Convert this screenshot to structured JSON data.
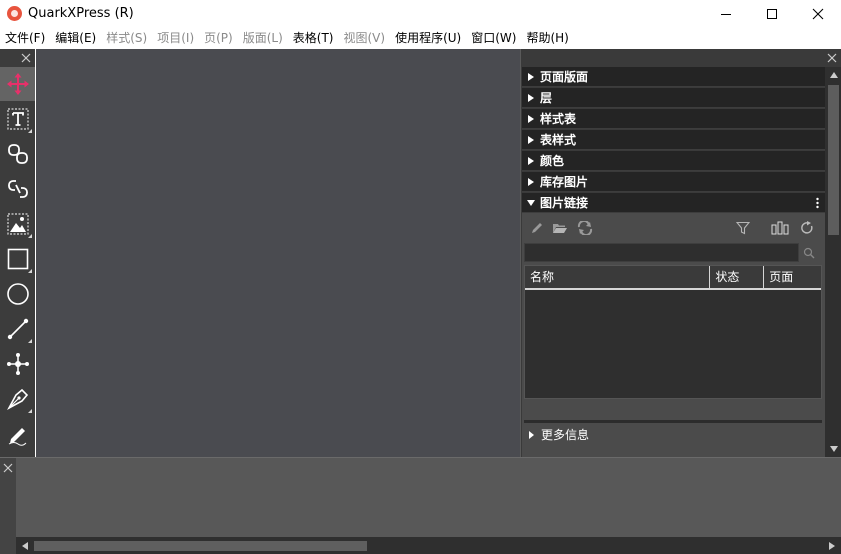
{
  "window": {
    "title": "QuarkXPress (R)"
  },
  "menu": {
    "items": [
      {
        "label": "文件(F)",
        "enabled": true
      },
      {
        "label": "编辑(E)",
        "enabled": true
      },
      {
        "label": "样式(S)",
        "enabled": false
      },
      {
        "label": "项目(I)",
        "enabled": false
      },
      {
        "label": "页(P)",
        "enabled": false
      },
      {
        "label": "版面(L)",
        "enabled": false
      },
      {
        "label": "表格(T)",
        "enabled": true
      },
      {
        "label": "视图(V)",
        "enabled": false
      },
      {
        "label": "使用程序(U)",
        "enabled": true
      },
      {
        "label": "窗口(W)",
        "enabled": true
      },
      {
        "label": "帮助(H)",
        "enabled": true
      }
    ]
  },
  "toolbox": {
    "tools": [
      {
        "icon": "move-tool-icon",
        "active": true
      },
      {
        "icon": "text-tool-icon"
      },
      {
        "icon": "link-tool-icon"
      },
      {
        "icon": "unlink-tool-icon"
      },
      {
        "icon": "picture-tool-icon"
      },
      {
        "icon": "rectangle-tool-icon"
      },
      {
        "icon": "oval-tool-icon"
      },
      {
        "icon": "line-tool-icon"
      },
      {
        "icon": "bezier-point-tool-icon"
      },
      {
        "icon": "pen-tool-icon"
      },
      {
        "icon": "freehand-pencil-tool-icon"
      }
    ]
  },
  "panel": {
    "sections": [
      {
        "label": "页面版面"
      },
      {
        "label": "层"
      },
      {
        "label": "样式表"
      },
      {
        "label": "表样式"
      },
      {
        "label": "颜色"
      },
      {
        "label": "库存图片"
      }
    ],
    "links": {
      "label": "图片链接",
      "search_value": "",
      "columns": [
        "名称",
        "状态",
        "页面"
      ],
      "more_info": "更多信息"
    }
  },
  "colors": {
    "accent": "#e8306a",
    "panel_header": "#242424",
    "canvas": "#4a4b50"
  }
}
